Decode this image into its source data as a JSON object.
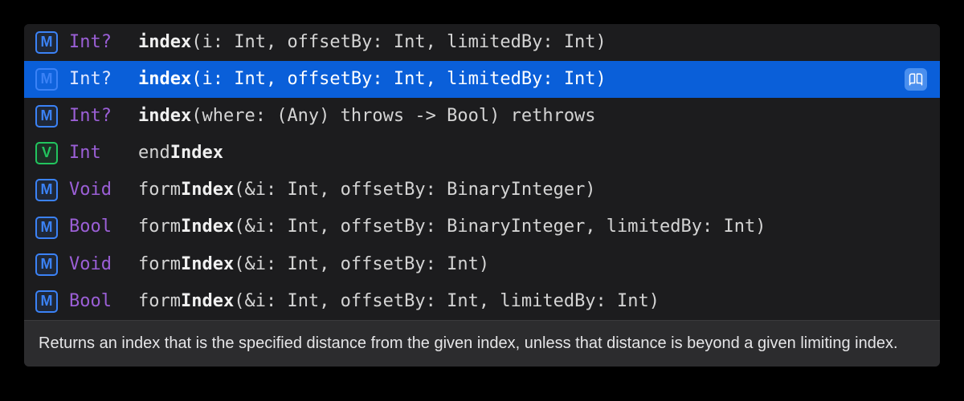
{
  "completions": [
    {
      "kind": "M",
      "kindClass": "kind-method",
      "returnType": "Int?",
      "prefix": "",
      "match": "index",
      "suffix": "(i: Int, offsetBy: Int, limitedBy: Int)",
      "selected": false
    },
    {
      "kind": "M",
      "kindClass": "kind-method",
      "returnType": "Int?",
      "prefix": "",
      "match": "index",
      "suffix": "(i: Int, offsetBy: Int, limitedBy: Int)",
      "selected": true
    },
    {
      "kind": "M",
      "kindClass": "kind-method",
      "returnType": "Int?",
      "prefix": "",
      "match": "index",
      "suffix": "(where: (Any) throws -> Bool) rethrows",
      "selected": false
    },
    {
      "kind": "V",
      "kindClass": "kind-variable",
      "returnType": "Int",
      "prefix": "end",
      "match": "Index",
      "suffix": "",
      "selected": false
    },
    {
      "kind": "M",
      "kindClass": "kind-method",
      "returnType": "Void",
      "prefix": "form",
      "match": "Index",
      "suffix": "(&i: Int, offsetBy: BinaryInteger)",
      "selected": false
    },
    {
      "kind": "M",
      "kindClass": "kind-method",
      "returnType": "Bool",
      "prefix": "form",
      "match": "Index",
      "suffix": "(&i: Int, offsetBy: BinaryInteger, limitedBy: Int)",
      "selected": false
    },
    {
      "kind": "M",
      "kindClass": "kind-method",
      "returnType": "Void",
      "prefix": "form",
      "match": "Index",
      "suffix": "(&i: Int, offsetBy: Int)",
      "selected": false
    },
    {
      "kind": "M",
      "kindClass": "kind-method",
      "returnType": "Bool",
      "prefix": "form",
      "match": "Index",
      "suffix": "(&i: Int, offsetBy: Int, limitedBy: Int)",
      "selected": false
    }
  ],
  "description": "Returns an index that is the specified distance from the given index, unless that distance is beyond a given limiting index."
}
